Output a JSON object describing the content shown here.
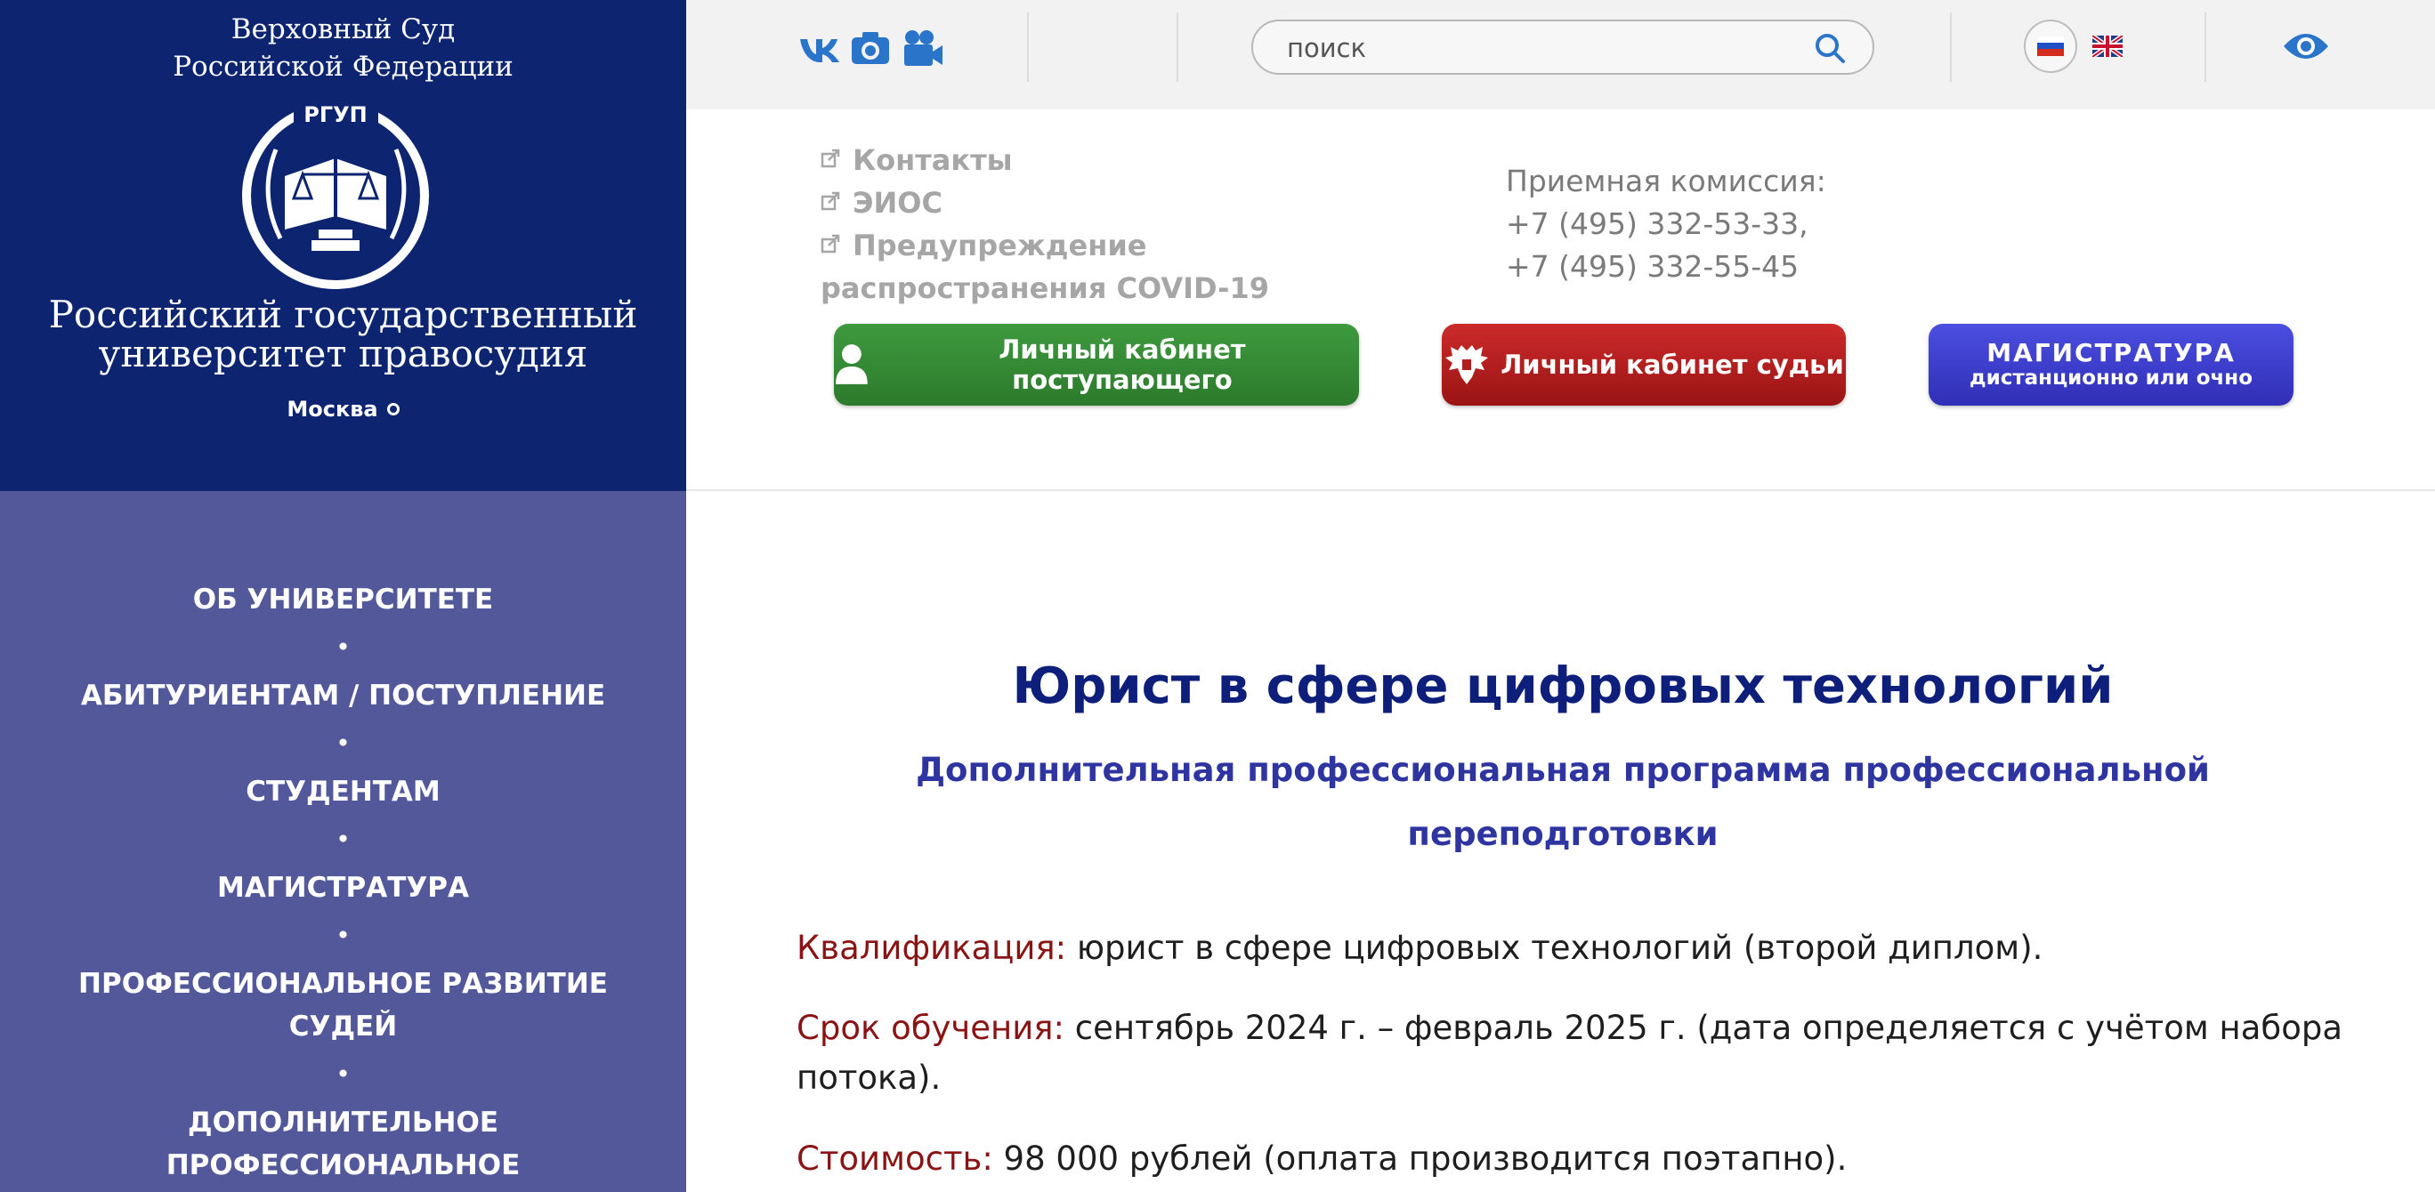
{
  "brand": {
    "court_line1": "Верховный Суд",
    "court_line2": "Российской Федерации",
    "emblem_text": "РГУП",
    "university_line1": "Российский государственный",
    "university_line2": "университет правосудия",
    "city": "Москва"
  },
  "nav": {
    "items": [
      {
        "label": "ОБ УНИВЕРСИТЕТЕ"
      },
      {
        "label": "АБИТУРИЕНТАМ / ПОСТУПЛЕНИЕ"
      },
      {
        "label": "СТУДЕНТАМ"
      },
      {
        "label": "МАГИСТРАТУРА"
      },
      {
        "label": "ПРОФЕССИОНАЛЬНОЕ РАЗВИТИЕ СУДЕЙ"
      },
      {
        "label": "ДОПОЛНИТЕЛЬНОЕ ПРОФЕССИОНАЛЬНОЕ"
      }
    ],
    "separator": "•"
  },
  "topbar": {
    "social_icons": [
      "vk-icon",
      "camera-icon",
      "video-camera-icon"
    ],
    "search_placeholder": "поиск",
    "languages": [
      "ru-flag-icon",
      "uk-flag-icon"
    ],
    "accessibility_icon": "eye-icon"
  },
  "links": [
    {
      "label": "Контакты"
    },
    {
      "label": "ЭИОС"
    },
    {
      "label": "Предупреждение распространения COVID-19"
    }
  ],
  "contacts": {
    "title": "Приемная комиссия:",
    "phone1": "+7 (495) 332-53-33,",
    "phone2": "+7 (495) 332-55-45"
  },
  "buttons": {
    "applicant": "Личный кабинет поступающего",
    "judge": "Личный кабинет судьи",
    "master_line1": "МАГИСТРАТУРА",
    "master_line2": "дистанционно или очно"
  },
  "main": {
    "title": "Юрист в сфере цифровых технологий",
    "subtitle": "Дополнительная профессиональная программа профессиональной переподготовки",
    "qualification_label": "Квалификация:",
    "qualification_value": " юрист в сфере цифровых технологий (второй диплом).",
    "duration_label": "Срок обучения:",
    "duration_value": " сентябрь 2024 г. – февраль 2025 г. (дата определяется с учётом набора потока).",
    "cost_label": "Стоимость:",
    "cost_value": " 98 000 рублей (оплата производится поэтапно)."
  },
  "colors": {
    "brand_blue": "#0d2570",
    "nav_purple": "#52589a",
    "title_navy": "#0d1f7a",
    "label_red": "#8a1414",
    "button_green": "#2c7a2c",
    "button_red": "#9a1414",
    "button_blue": "#2f2fb6",
    "icon_blue": "#2a75c9"
  }
}
